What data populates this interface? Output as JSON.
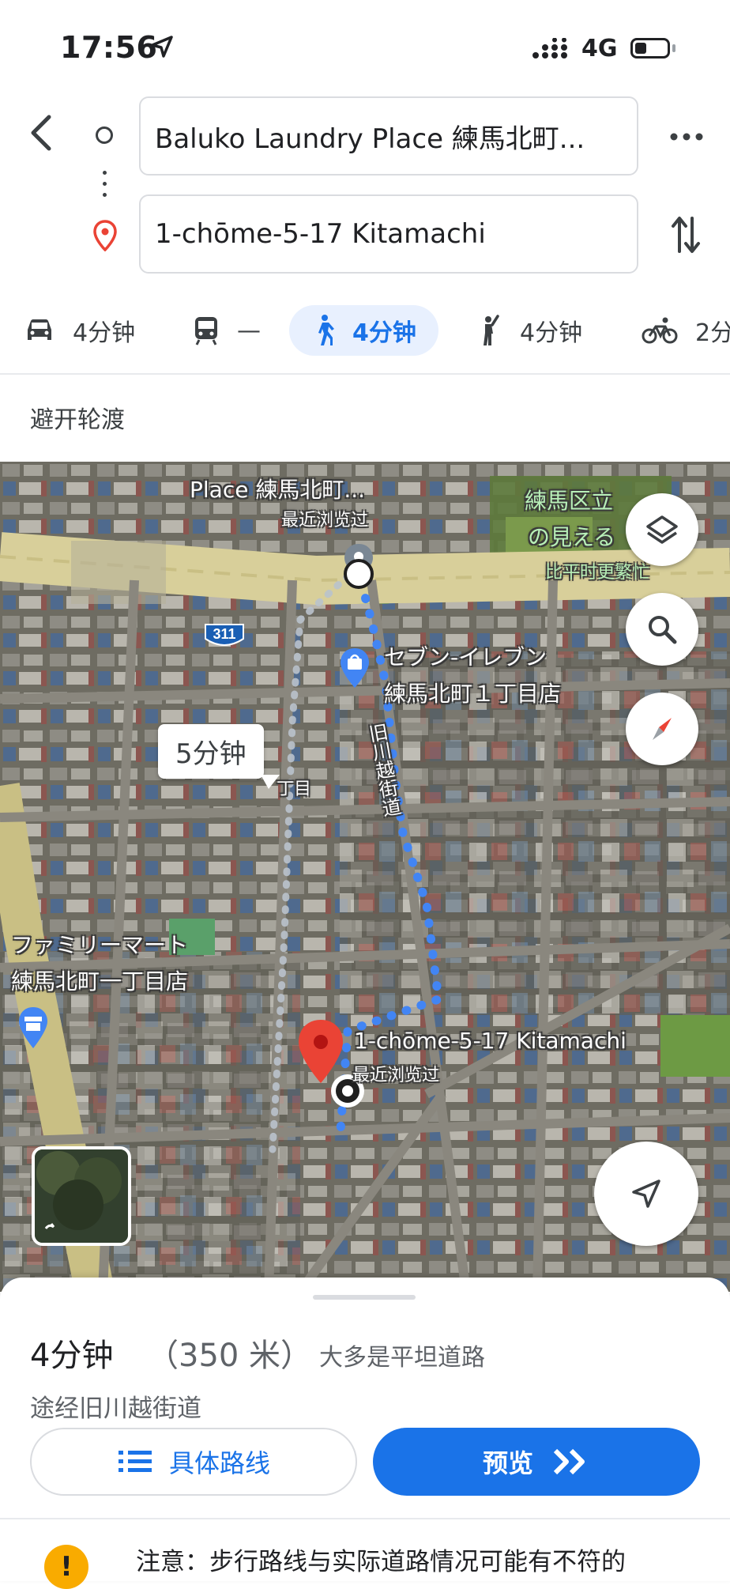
{
  "status_bar": {
    "time": "17:56",
    "network": "4G"
  },
  "route": {
    "origin": "Baluko Laundry Place 練馬北町...",
    "destination": "1-chōme-5-17 Kitamachi"
  },
  "modes": [
    {
      "icon": "car-icon",
      "label": "4分钟"
    },
    {
      "icon": "transit-icon",
      "label": "—"
    },
    {
      "icon": "walk-icon",
      "label": "4分钟",
      "selected": true
    },
    {
      "icon": "hail-icon",
      "label": "4分钟"
    },
    {
      "icon": "bike-icon",
      "label": "2分"
    }
  ],
  "options": {
    "avoid_label": "避开轮渡"
  },
  "map": {
    "origin_label": "Place 練馬北町...",
    "origin_sub": "最近浏览过",
    "park_label_1": "練馬区立",
    "park_label_2": "の見える",
    "park_label_3": "比平时更繁忙",
    "road_badge": "311",
    "store_label_1": "セブン-イレブン",
    "store_label_2": "練馬北町１丁目店",
    "eta_bubble": "5分钟",
    "street_fragment": "丁目",
    "street_name": "旧川越街道",
    "family_label_1": "ファミリーマート",
    "family_label_2": "練馬北町一丁目店",
    "dest_label": "1-chōme-5-17 Kitamachi",
    "dest_sub": "最近浏览过"
  },
  "summary": {
    "duration": "4分钟",
    "distance": "（350 米）",
    "terrain": "大多是平坦道路",
    "via": "途经旧川越街道",
    "steps_button": "具体路线",
    "preview_button": "预览",
    "warning": "注意：步行路线与实际道路情况可能有不符的"
  },
  "colors": {
    "accent": "#1a73e8",
    "route": "#4285f4",
    "pin": "#ea4335",
    "warning": "#f9ab00"
  }
}
